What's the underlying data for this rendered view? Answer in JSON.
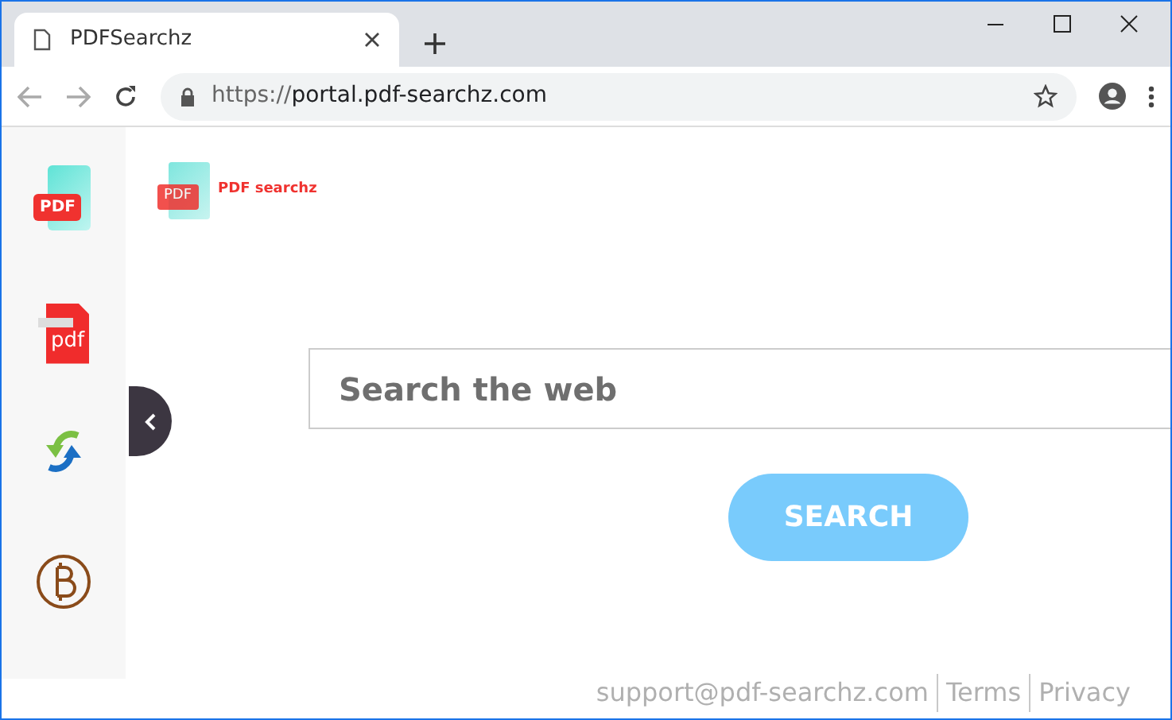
{
  "window": {
    "tab_title": "PDFSearchz",
    "url_scheme": "https://",
    "url_host": "portal.pdf-searchz.com"
  },
  "sidebar": {
    "items": [
      {
        "kind": "pdf-badge",
        "label": "PDF"
      },
      {
        "kind": "pdf-doc",
        "label": "pdf"
      },
      {
        "kind": "sync"
      },
      {
        "kind": "coin"
      }
    ]
  },
  "logo": {
    "badge": "PDF",
    "text": "PDF searchz"
  },
  "search": {
    "placeholder": "Search the web",
    "button": "SEARCH"
  },
  "footer": {
    "links": [
      "support@pdf-searchz.com",
      "Terms",
      "Privacy"
    ]
  }
}
